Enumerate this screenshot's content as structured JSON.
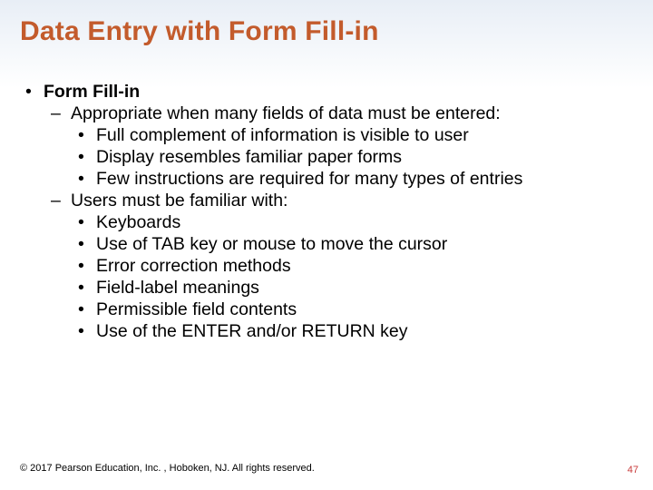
{
  "title": "Data Entry with Form Fill-in",
  "bullets": {
    "l1": "Form Fill-in",
    "l2a": "Appropriate when many fields of data must be entered:",
    "l2a_subs": [
      "Full complement of information is visible to user",
      "Display resembles familiar paper forms",
      "Few instructions are required for many types of entries"
    ],
    "l2b": "Users must be familiar with:",
    "l2b_subs": [
      "Keyboards",
      "Use of TAB key or mouse to move the cursor",
      "Error correction methods",
      "Field-label meanings",
      "Permissible field contents",
      "Use of the ENTER and/or RETURN key"
    ]
  },
  "footer": "© 2017 Pearson Education, Inc. , Hoboken, NJ.  All rights reserved.",
  "pageNumber": "47"
}
